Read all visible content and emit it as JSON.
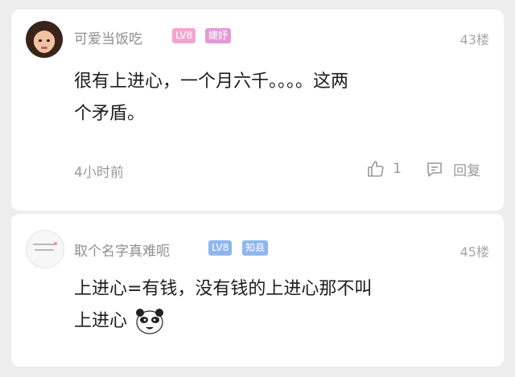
{
  "comments": [
    {
      "username": "可爱当饭吃",
      "level": "LV8",
      "title_badge": "婕妤",
      "floor": "43楼",
      "content_line1": "很有上进心，一个月六千。。。。这两",
      "content_line2": "个矛盾。",
      "time": "4小时前",
      "like_count": "1",
      "reply_label": "回复",
      "colors": {
        "level": "#f3a6cf",
        "title": "#e49ad6"
      }
    },
    {
      "username": "取个名字真难呃",
      "level": "LV8",
      "title_badge": "知县",
      "floor": "45楼",
      "content_line1": "上进心=有钱，没有钱的上进心那不叫",
      "content_line2": "上进心",
      "emoji": "panda-meme-sticker",
      "colors": {
        "level": "#8fb6ee",
        "title": "#8fb6ee"
      }
    }
  ],
  "icons": [
    "thumbs-up-icon",
    "comment-bubble-icon"
  ]
}
